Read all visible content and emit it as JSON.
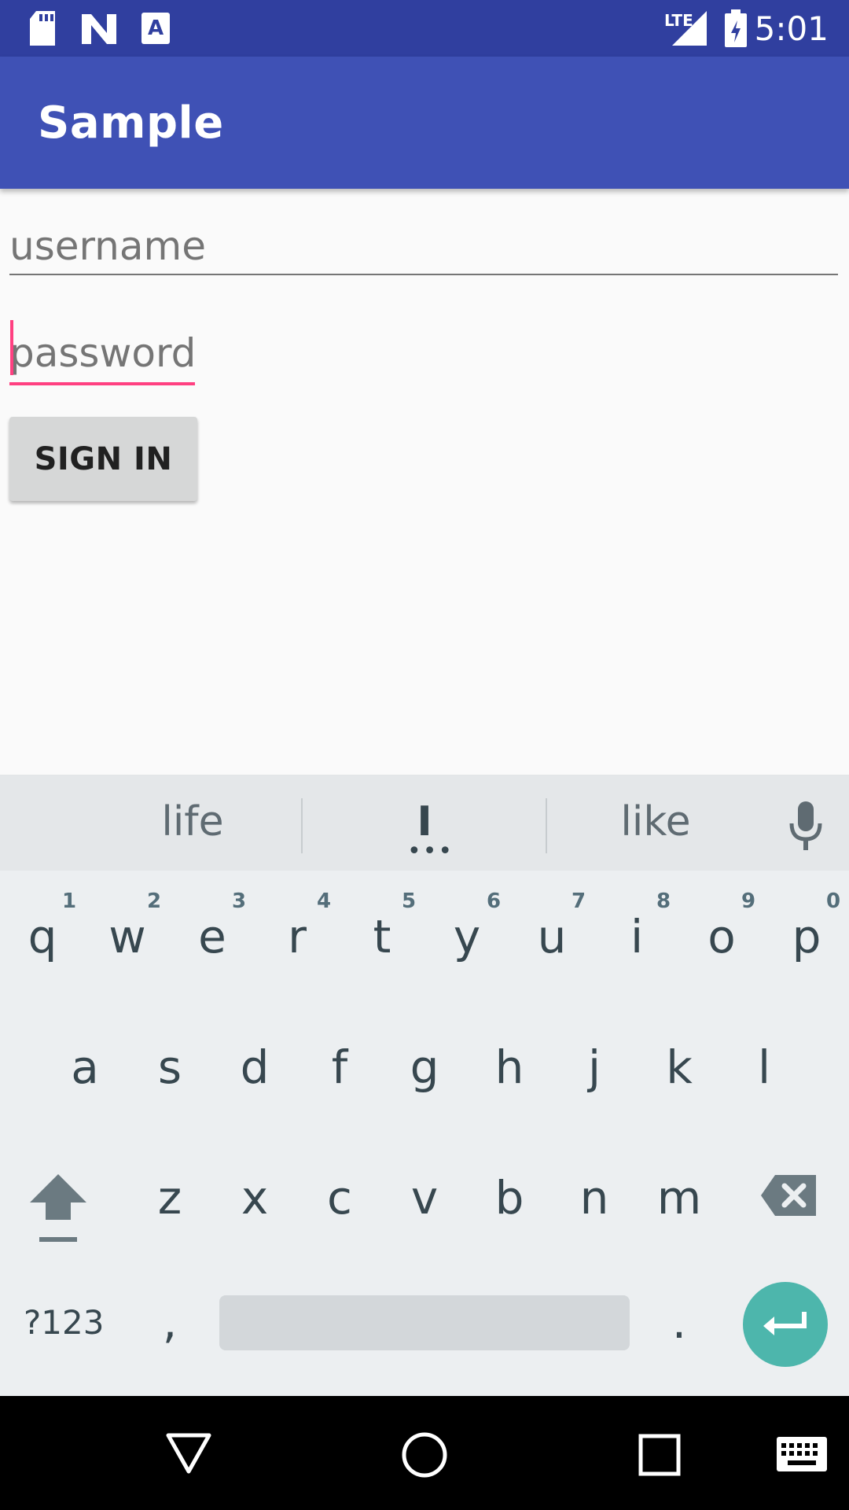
{
  "status_bar": {
    "time": "5:01",
    "network": "LTE",
    "icons": [
      "sd-card-icon",
      "n-logo-icon",
      "font-a-icon",
      "lte-signal-icon",
      "battery-charging-icon"
    ]
  },
  "app_bar": {
    "title": "Sample"
  },
  "form": {
    "username_placeholder": "username",
    "password_placeholder": "password",
    "signin_label": "SIGN IN"
  },
  "keyboard": {
    "suggestions": [
      "life",
      "I",
      "like"
    ],
    "row1": [
      "q",
      "w",
      "e",
      "r",
      "t",
      "y",
      "u",
      "i",
      "o",
      "p"
    ],
    "row1_hints": [
      "1",
      "2",
      "3",
      "4",
      "5",
      "6",
      "7",
      "8",
      "9",
      "0"
    ],
    "row2": [
      "a",
      "s",
      "d",
      "f",
      "g",
      "h",
      "j",
      "k",
      "l"
    ],
    "row3": [
      "z",
      "x",
      "c",
      "v",
      "b",
      "n",
      "m"
    ],
    "symbols_label": "?123",
    "comma": ",",
    "period": "."
  },
  "colors": {
    "status_bar": "#303F9F",
    "app_bar": "#3F51B5",
    "accent": "#FF4081",
    "enter_key": "#4DB6AC"
  },
  "nav_bar": {
    "icons": [
      "back-icon",
      "home-icon",
      "recents-icon",
      "keyboard-icon"
    ]
  }
}
